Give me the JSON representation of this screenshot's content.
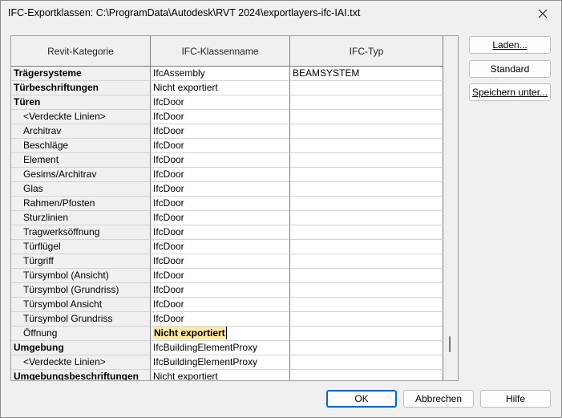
{
  "window": {
    "title": "IFC-Exportklassen: C:\\ProgramData\\Autodesk\\RVT 2024\\exportlayers-ifc-IAI.txt",
    "close_icon": "close-icon"
  },
  "table": {
    "headers": [
      "Revit-Kategorie",
      "IFC-Klassenname",
      "IFC-Typ"
    ],
    "rows": [
      {
        "category": "Trägersysteme",
        "class": "IfcAssembly",
        "type": "BEAMSYSTEM",
        "bold": true,
        "indent": false
      },
      {
        "category": "Türbeschriftungen",
        "class": "Nicht exportiert",
        "type": "",
        "bold": true,
        "indent": false
      },
      {
        "category": "Türen",
        "class": "IfcDoor",
        "type": "",
        "bold": true,
        "indent": false
      },
      {
        "category": "<Verdeckte Linien>",
        "class": "IfcDoor",
        "type": "",
        "bold": false,
        "indent": true
      },
      {
        "category": "Architrav",
        "class": "IfcDoor",
        "type": "",
        "bold": false,
        "indent": true
      },
      {
        "category": "Beschläge",
        "class": "IfcDoor",
        "type": "",
        "bold": false,
        "indent": true
      },
      {
        "category": "Element",
        "class": "IfcDoor",
        "type": "",
        "bold": false,
        "indent": true
      },
      {
        "category": "Gesims/Architrav",
        "class": "IfcDoor",
        "type": "",
        "bold": false,
        "indent": true
      },
      {
        "category": "Glas",
        "class": "IfcDoor",
        "type": "",
        "bold": false,
        "indent": true
      },
      {
        "category": "Rahmen/Pfosten",
        "class": "IfcDoor",
        "type": "",
        "bold": false,
        "indent": true
      },
      {
        "category": "Sturzlinien",
        "class": "IfcDoor",
        "type": "",
        "bold": false,
        "indent": true
      },
      {
        "category": "Tragwerksöffnung",
        "class": "IfcDoor",
        "type": "",
        "bold": false,
        "indent": true
      },
      {
        "category": "Türflügel",
        "class": "IfcDoor",
        "type": "",
        "bold": false,
        "indent": true
      },
      {
        "category": "Türgriff",
        "class": "IfcDoor",
        "type": "",
        "bold": false,
        "indent": true
      },
      {
        "category": "Türsymbol (Ansicht)",
        "class": "IfcDoor",
        "type": "",
        "bold": false,
        "indent": true
      },
      {
        "category": "Türsymbol (Grundriss)",
        "class": "IfcDoor",
        "type": "",
        "bold": false,
        "indent": true
      },
      {
        "category": "Türsymbol Ansicht",
        "class": "IfcDoor",
        "type": "",
        "bold": false,
        "indent": true
      },
      {
        "category": "Türsymbol Grundriss",
        "class": "IfcDoor",
        "type": "",
        "bold": false,
        "indent": true
      },
      {
        "category": "Öffnung",
        "class": "Nicht exportiert",
        "type": "",
        "bold": false,
        "indent": true,
        "selected": true
      },
      {
        "category": "Umgebung",
        "class": "IfcBuildingElementProxy",
        "type": "",
        "bold": true,
        "indent": false
      },
      {
        "category": "<Verdeckte Linien>",
        "class": "IfcBuildingElementProxy",
        "type": "",
        "bold": false,
        "indent": true
      },
      {
        "category": "Umgebungsbeschriftungen",
        "class": "Nicht exportiert",
        "type": "",
        "bold": true,
        "indent": false
      }
    ]
  },
  "buttons": {
    "load": "Laden...",
    "standard": "Standard",
    "save_as": "Speichern unter...",
    "ok": "OK",
    "cancel": "Abbrechen",
    "help": "Hilfe"
  },
  "colors": {
    "selection": "#ffe8a6",
    "primary_border": "#0067c0"
  }
}
